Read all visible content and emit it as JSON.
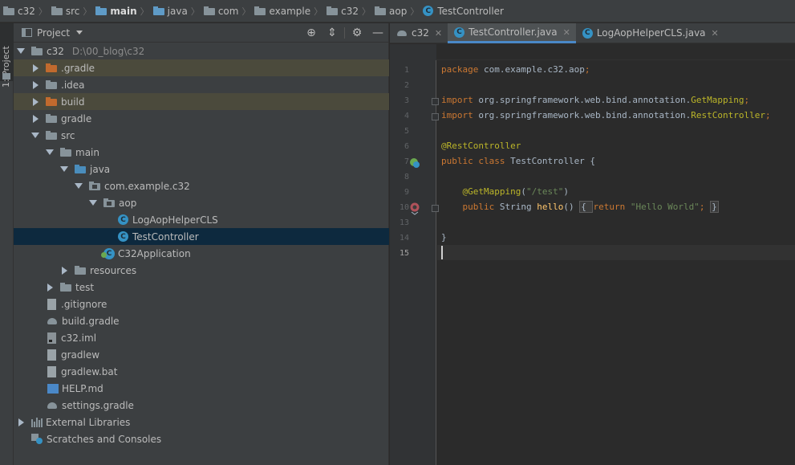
{
  "breadcrumb": [
    {
      "label": "c32",
      "icon": "project-folder-icon",
      "bold": false
    },
    {
      "label": "src",
      "icon": "folder-icon",
      "bold": false
    },
    {
      "label": "main",
      "icon": "source-folder-icon",
      "bold": true
    },
    {
      "label": "java",
      "icon": "source-folder-icon",
      "bold": false
    },
    {
      "label": "com",
      "icon": "folder-icon",
      "bold": false
    },
    {
      "label": "example",
      "icon": "folder-icon",
      "bold": false
    },
    {
      "label": "c32",
      "icon": "folder-icon",
      "bold": false
    },
    {
      "label": "aop",
      "icon": "folder-icon",
      "bold": false
    },
    {
      "label": "TestController",
      "icon": "class-icon",
      "bold": false
    }
  ],
  "side_strip": {
    "label": "1: Project"
  },
  "project_panel": {
    "title": "Project",
    "tools": [
      "locate-icon",
      "collapse-icon",
      "gear-icon",
      "minimize-icon"
    ],
    "tree": [
      {
        "label": "c32",
        "path": "D:\\00_blog\\c32",
        "depth": 0,
        "arrow": "down",
        "icon": "module",
        "state": ""
      },
      {
        "label": ".gradle",
        "depth": 1,
        "arrow": "right",
        "icon": "orange",
        "state": "hl"
      },
      {
        "label": ".idea",
        "depth": 1,
        "arrow": "right",
        "icon": "grey",
        "state": ""
      },
      {
        "label": "build",
        "depth": 1,
        "arrow": "right",
        "icon": "orange",
        "state": "hl"
      },
      {
        "label": "gradle",
        "depth": 1,
        "arrow": "right",
        "icon": "grey",
        "state": ""
      },
      {
        "label": "src",
        "depth": 1,
        "arrow": "down",
        "icon": "grey",
        "state": ""
      },
      {
        "label": "main",
        "depth": 2,
        "arrow": "down",
        "icon": "grey",
        "state": ""
      },
      {
        "label": "java",
        "depth": 3,
        "arrow": "down",
        "icon": "blue",
        "state": ""
      },
      {
        "label": "com.example.c32",
        "depth": 4,
        "arrow": "down",
        "icon": "pkg",
        "state": ""
      },
      {
        "label": "aop",
        "depth": 5,
        "arrow": "down",
        "icon": "pkg",
        "state": ""
      },
      {
        "label": "LogAopHelperCLS",
        "depth": 6,
        "arrow": "none",
        "icon": "class",
        "state": ""
      },
      {
        "label": "TestController",
        "depth": 6,
        "arrow": "none",
        "icon": "class",
        "state": "sel"
      },
      {
        "label": "C32Application",
        "depth": 5,
        "arrow": "none",
        "icon": "app",
        "state": ""
      },
      {
        "label": "resources",
        "depth": 3,
        "arrow": "right",
        "icon": "res",
        "state": ""
      },
      {
        "label": "test",
        "depth": 2,
        "arrow": "right",
        "icon": "grey",
        "state": ""
      },
      {
        "label": ".gitignore",
        "depth": 1,
        "arrow": "none",
        "icon": "file",
        "state": ""
      },
      {
        "label": "build.gradle",
        "depth": 1,
        "arrow": "none",
        "icon": "gradle",
        "state": ""
      },
      {
        "label": "c32.iml",
        "depth": 1,
        "arrow": "none",
        "icon": "filedark",
        "state": ""
      },
      {
        "label": "gradlew",
        "depth": 1,
        "arrow": "none",
        "icon": "file",
        "state": ""
      },
      {
        "label": "gradlew.bat",
        "depth": 1,
        "arrow": "none",
        "icon": "file",
        "state": ""
      },
      {
        "label": "HELP.md",
        "depth": 1,
        "arrow": "none",
        "icon": "md",
        "state": ""
      },
      {
        "label": "settings.gradle",
        "depth": 1,
        "arrow": "none",
        "icon": "gradle",
        "state": ""
      },
      {
        "label": "External Libraries",
        "depth": 0,
        "arrow": "right",
        "icon": "lib",
        "state": ""
      },
      {
        "label": "Scratches and Consoles",
        "depth": 0,
        "arrow": "none",
        "icon": "scratch",
        "state": ""
      }
    ]
  },
  "editor_tabs": [
    {
      "label": "c32",
      "icon": "gradle-elephant-icon",
      "active": false,
      "close": "✕"
    },
    {
      "label": "TestController.java",
      "icon": "class-icon",
      "active": true,
      "close": "✕"
    },
    {
      "label": "LogAopHelperCLS.java",
      "icon": "class-icon",
      "active": false,
      "close": "✕"
    }
  ],
  "code": {
    "current_line": 15,
    "lines": [
      {
        "n": "1",
        "tokens": [
          {
            "t": "package ",
            "c": "kw"
          },
          {
            "t": "com.example.c32.aop",
            "c": ""
          },
          {
            "t": ";",
            "c": "kw"
          }
        ]
      },
      {
        "n": "2",
        "tokens": []
      },
      {
        "n": "3",
        "tokens": [
          {
            "t": "import ",
            "c": "kw"
          },
          {
            "t": "org.springframework.web.bind.annotation.",
            "c": ""
          },
          {
            "t": "GetMapping",
            "c": "an"
          },
          {
            "t": ";",
            "c": "kw"
          }
        ]
      },
      {
        "n": "4",
        "tokens": [
          {
            "t": "import ",
            "c": "kw"
          },
          {
            "t": "org.springframework.web.bind.annotation.",
            "c": ""
          },
          {
            "t": "RestController",
            "c": "an"
          },
          {
            "t": ";",
            "c": "kw"
          }
        ]
      },
      {
        "n": "5",
        "tokens": []
      },
      {
        "n": "6",
        "tokens": [
          {
            "t": "@RestController",
            "c": "an"
          }
        ]
      },
      {
        "n": "7",
        "tokens": [
          {
            "t": "public class ",
            "c": "kw"
          },
          {
            "t": "TestController {",
            "c": ""
          }
        ]
      },
      {
        "n": "8",
        "tokens": []
      },
      {
        "n": "9",
        "tokens": [
          {
            "t": "    ",
            "c": ""
          },
          {
            "t": "@GetMapping",
            "c": "an"
          },
          {
            "t": "(",
            "c": ""
          },
          {
            "t": "\"/test\"",
            "c": "st"
          },
          {
            "t": ")",
            "c": ""
          }
        ]
      },
      {
        "n": "10",
        "tokens": [
          {
            "t": "    ",
            "c": ""
          },
          {
            "t": "public ",
            "c": "kw"
          },
          {
            "t": "String ",
            "c": ""
          },
          {
            "t": "hello",
            "c": "fn"
          },
          {
            "t": "() ",
            "c": ""
          },
          {
            "t": "{ ",
            "c": "box"
          },
          {
            "t": "return ",
            "c": "kw"
          },
          {
            "t": "\"Hello World\"",
            "c": "st"
          },
          {
            "t": "; ",
            "c": "kw"
          },
          {
            "t": "}",
            "c": "box"
          }
        ]
      },
      {
        "n": "13",
        "tokens": []
      },
      {
        "n": "14",
        "tokens": [
          {
            "t": "}",
            "c": ""
          }
        ]
      },
      {
        "n": "15",
        "tokens": []
      }
    ]
  }
}
